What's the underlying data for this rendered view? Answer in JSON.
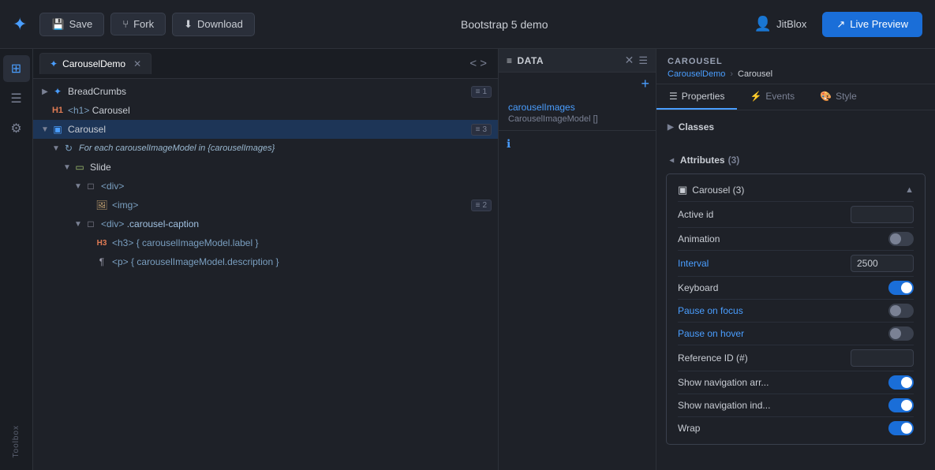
{
  "topbar": {
    "save_label": "Save",
    "fork_label": "Fork",
    "download_label": "Download",
    "title": "Bootstrap 5 demo",
    "user": "JitBlox",
    "live_preview_label": "Live Preview"
  },
  "sidebar": {
    "icons": [
      "⊞",
      "☰",
      "⚙"
    ]
  },
  "tree": {
    "tab_label": "CarouselDemo",
    "items": [
      {
        "indent": 0,
        "arrow": "▶",
        "icon": "puzzle",
        "label": "BreadCrumbs",
        "badge": "1",
        "badge_icon": "≡"
      },
      {
        "indent": 0,
        "arrow": "",
        "icon": "h1",
        "label": "<h1> Carousel",
        "badge": "",
        "badge_icon": ""
      },
      {
        "indent": 0,
        "arrow": "▼",
        "icon": "carousel",
        "label": "Carousel",
        "badge": "3",
        "badge_icon": "≡",
        "selected": true
      },
      {
        "indent": 1,
        "arrow": "▼",
        "icon": "repeat",
        "label": "For each carouselImageModel in {carouselImages}",
        "badge": "",
        "badge_icon": ""
      },
      {
        "indent": 2,
        "arrow": "▼",
        "icon": "slide",
        "label": "Slide",
        "badge": "",
        "badge_icon": ""
      },
      {
        "indent": 3,
        "arrow": "▼",
        "icon": "div",
        "label": "<div>",
        "badge": "",
        "badge_icon": ""
      },
      {
        "indent": 4,
        "arrow": "",
        "icon": "img",
        "label": "<img>",
        "badge": "2",
        "badge_icon": "≡"
      },
      {
        "indent": 3,
        "arrow": "▼",
        "icon": "div",
        "label": "<div> .carousel-caption",
        "badge": "",
        "badge_icon": ""
      },
      {
        "indent": 4,
        "arrow": "",
        "icon": "h3",
        "label": "<h3> { carouselImageModel.label }",
        "badge": "",
        "badge_icon": ""
      },
      {
        "indent": 4,
        "arrow": "",
        "icon": "p",
        "label": "<p> { carouselImageModel.description }",
        "badge": "",
        "badge_icon": ""
      }
    ]
  },
  "data_panel": {
    "title": "DATA",
    "item": {
      "name": "carouselImages",
      "type": "CarouselImageModel []"
    }
  },
  "props_panel": {
    "section_title": "CAROUSEL",
    "breadcrumb_parent": "CarouselDemo",
    "breadcrumb_sep": "›",
    "breadcrumb_current": "Carousel",
    "tabs": [
      {
        "label": "Properties",
        "icon": "☰",
        "active": true
      },
      {
        "label": "Events",
        "icon": "⚡"
      },
      {
        "label": "Style",
        "icon": "🎨"
      }
    ],
    "classes_label": "Classes",
    "attributes_label": "Attributes",
    "attributes_count": "3",
    "group_title": "Carousel (3)",
    "attrs": [
      {
        "label": "Active id",
        "type": "input",
        "value": ""
      },
      {
        "label": "Animation",
        "type": "toggle-off"
      },
      {
        "label": "Interval",
        "type": "input-link",
        "value": "2500"
      },
      {
        "label": "Keyboard",
        "type": "toggle-on"
      },
      {
        "label": "Pause on focus",
        "type": "toggle-off"
      },
      {
        "label": "Pause on hover",
        "type": "toggle-off"
      },
      {
        "label": "Reference ID (#)",
        "type": "input",
        "value": ""
      },
      {
        "label": "Show navigation arr...",
        "type": "toggle-on"
      },
      {
        "label": "Show navigation ind...",
        "type": "toggle-on"
      },
      {
        "label": "Wrap",
        "type": "toggle-on"
      }
    ]
  }
}
